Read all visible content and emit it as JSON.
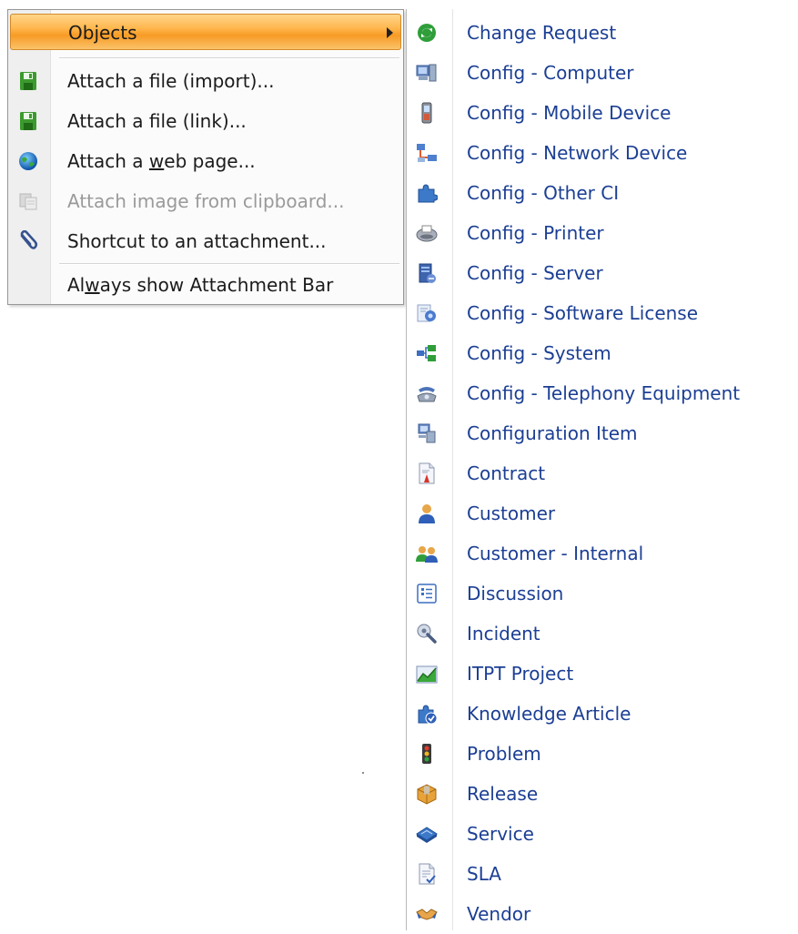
{
  "context_menu": {
    "objects_label": "Objects",
    "items": [
      {
        "label": "Attach a file (import)...",
        "icon": "floppy-disk-icon",
        "disabled": false
      },
      {
        "label": "Attach a file (link)...",
        "icon": "floppy-disk-icon",
        "disabled": false
      },
      {
        "label_before": "Attach a ",
        "label_underlined": "w",
        "label_after": "eb page...",
        "icon": "globe-icon",
        "disabled": false
      },
      {
        "label": "Attach image from clipboard...",
        "icon": "clipboard-image-icon",
        "disabled": true
      },
      {
        "label": "Shortcut to an attachment...",
        "icon": "paperclip-icon",
        "disabled": false
      }
    ],
    "always_show": {
      "label_before": "Al",
      "label_underlined": "w",
      "label_after": "ays show Attachment Bar"
    }
  },
  "objects_submenu": {
    "items": [
      {
        "label": "Change Request",
        "icon": "change-request-icon"
      },
      {
        "label": "Config - Computer",
        "icon": "computer-icon"
      },
      {
        "label": "Config - Mobile Device",
        "icon": "mobile-device-icon"
      },
      {
        "label": "Config - Network Device",
        "icon": "network-device-icon"
      },
      {
        "label": "Config - Other CI",
        "icon": "puzzle-icon"
      },
      {
        "label": "Config - Printer",
        "icon": "printer-icon"
      },
      {
        "label": "Config - Server",
        "icon": "server-icon"
      },
      {
        "label": "Config - Software License",
        "icon": "software-license-icon"
      },
      {
        "label": "Config - System",
        "icon": "system-icon"
      },
      {
        "label": "Config - Telephony Equipment",
        "icon": "telephone-icon"
      },
      {
        "label": "Configuration Item",
        "icon": "configuration-item-icon"
      },
      {
        "label": "Contract",
        "icon": "contract-icon"
      },
      {
        "label": "Customer",
        "icon": "customer-icon"
      },
      {
        "label": "Customer - Internal",
        "icon": "internal-customers-icon"
      },
      {
        "label": "Discussion",
        "icon": "discussion-icon"
      },
      {
        "label": "Incident",
        "icon": "incident-icon"
      },
      {
        "label": "ITPT Project",
        "icon": "project-chart-icon"
      },
      {
        "label": "Knowledge Article",
        "icon": "knowledge-article-icon"
      },
      {
        "label": "Problem",
        "icon": "traffic-light-icon"
      },
      {
        "label": "Release",
        "icon": "release-box-icon"
      },
      {
        "label": "Service",
        "icon": "service-book-icon"
      },
      {
        "label": "SLA",
        "icon": "sla-document-icon"
      },
      {
        "label": "Vendor",
        "icon": "handshake-icon"
      }
    ]
  },
  "colors": {
    "highlight": "#f9a73a",
    "submenu_text": "#1c3f94",
    "disabled_text": "#9a9a9a"
  }
}
